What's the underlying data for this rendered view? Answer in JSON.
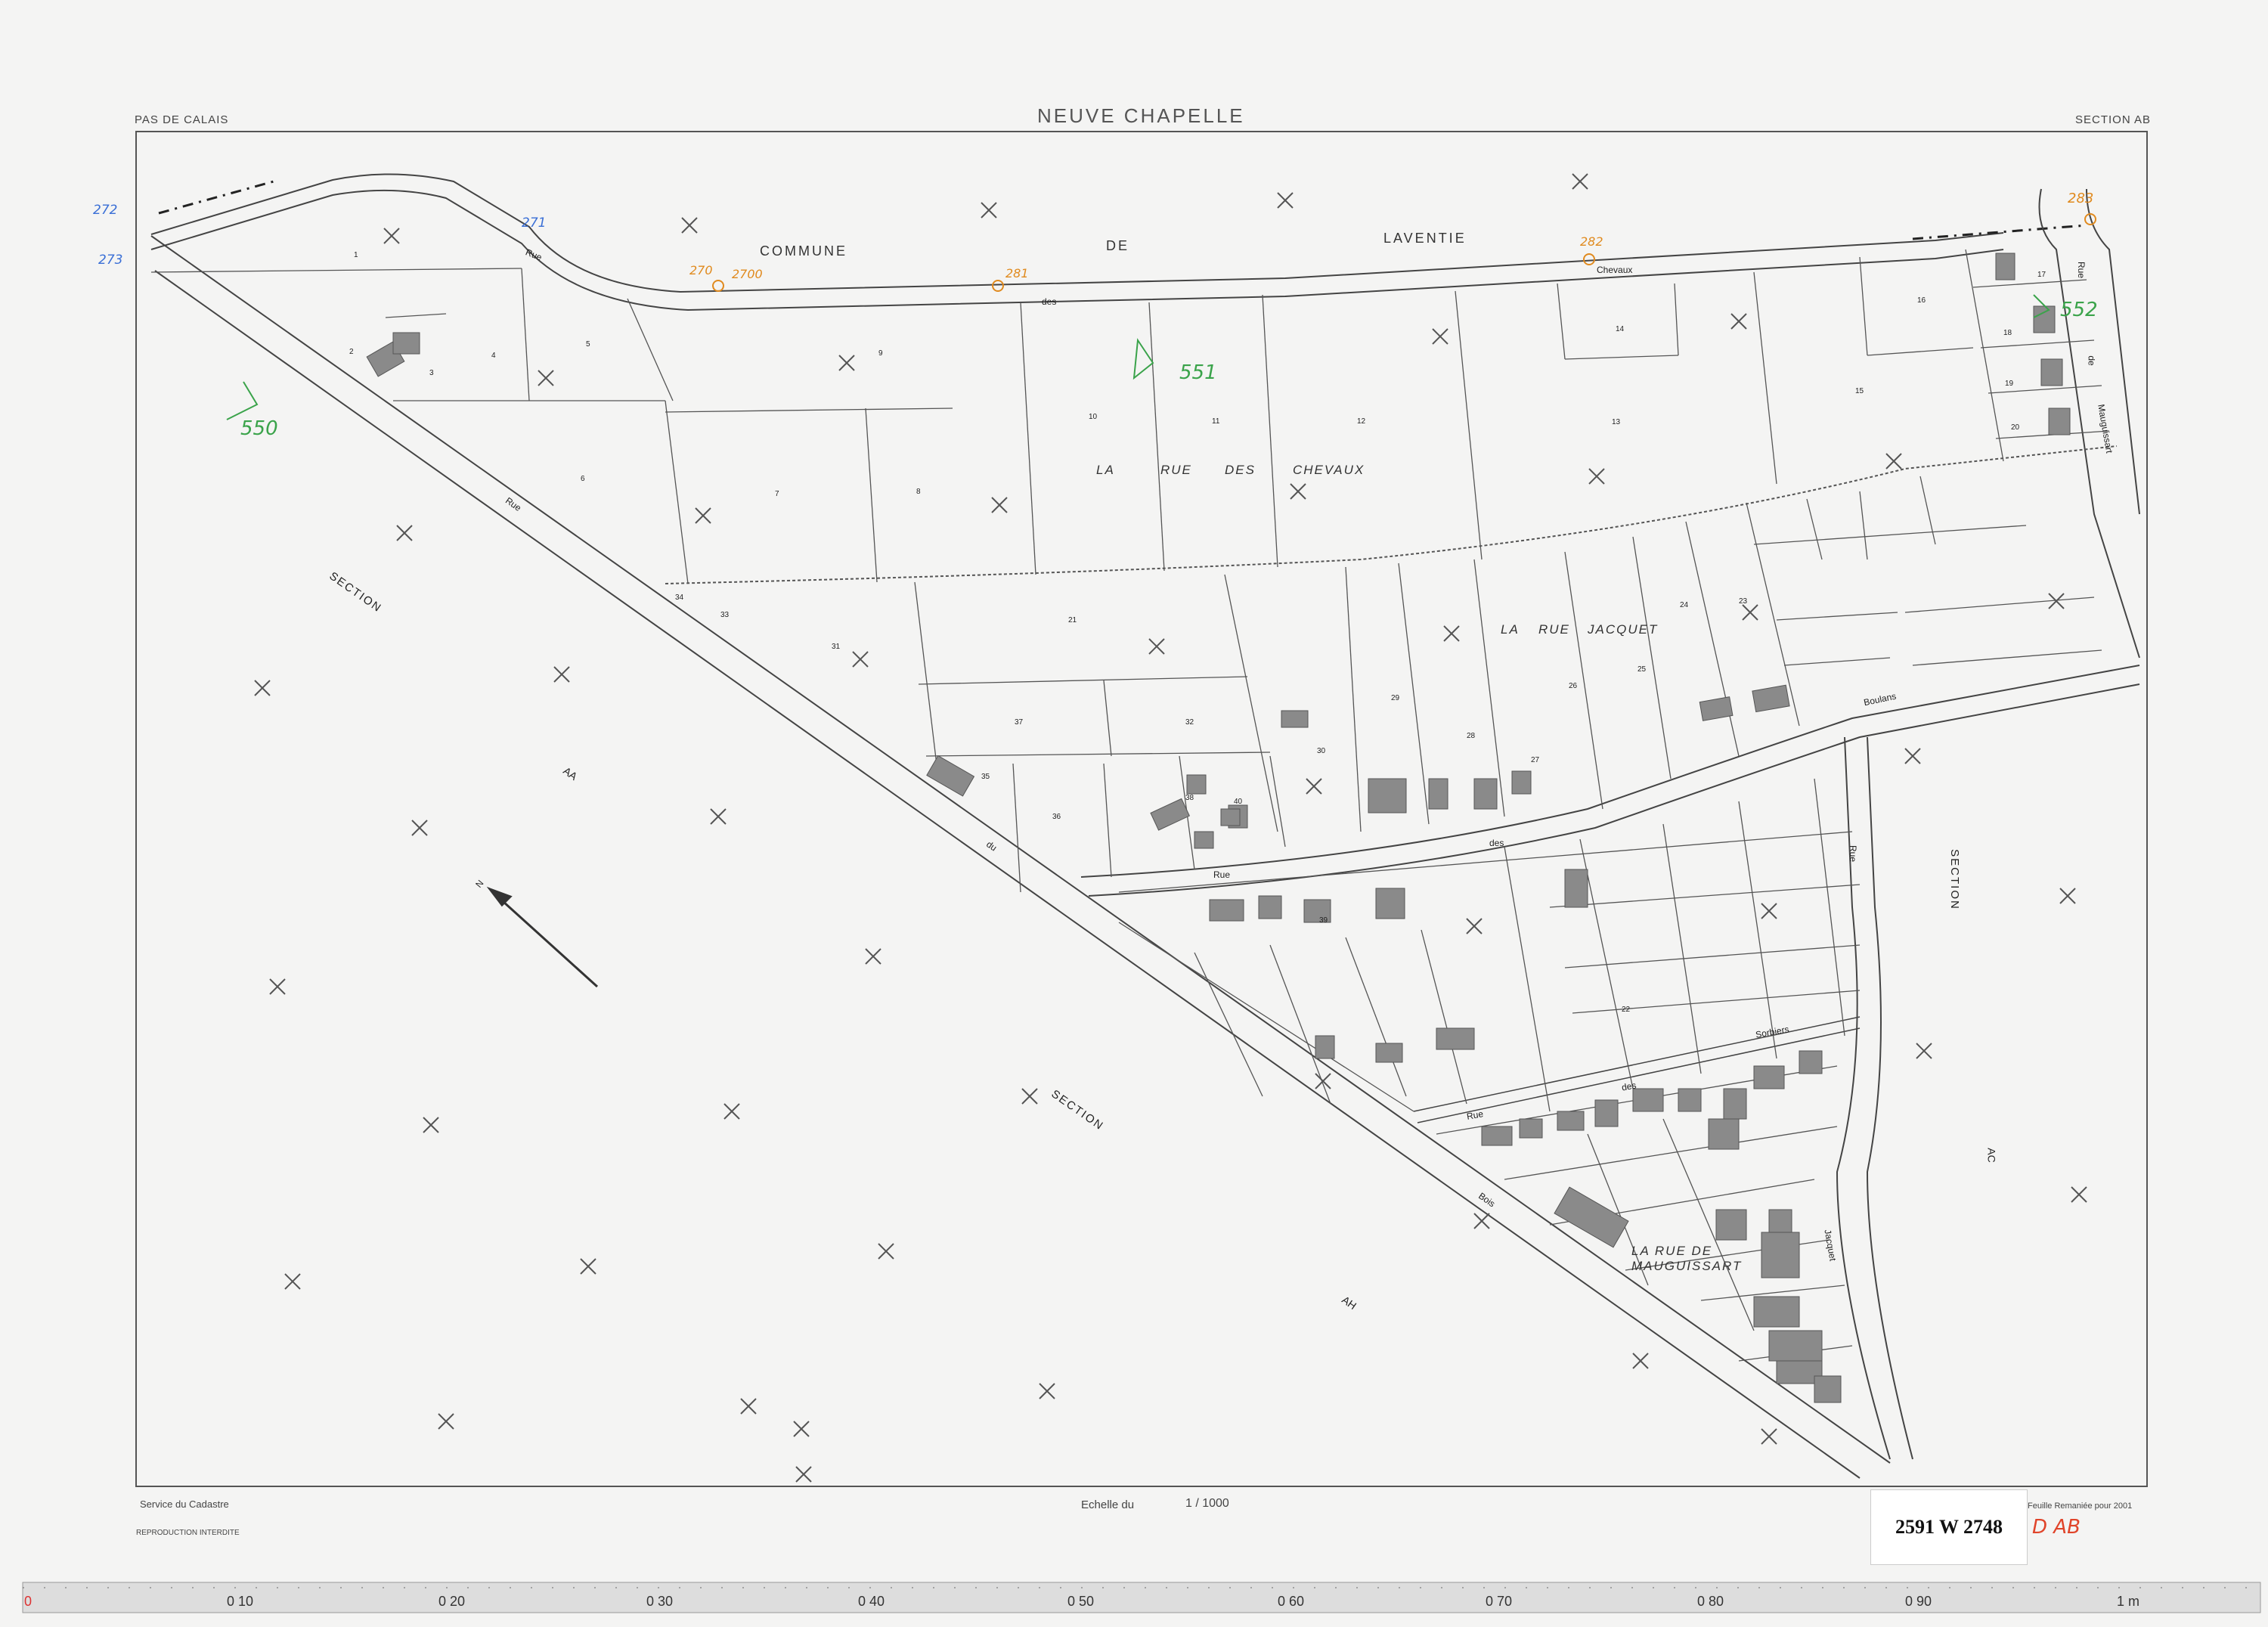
{
  "header": {
    "department": "PAS DE CALAIS",
    "commune": "NEUVE CHAPELLE",
    "section": "SECTION AB"
  },
  "footer": {
    "service": "Service du Cadastre",
    "reproduction": "REPRODUCTION   INTERDITE",
    "scale_label": "Echelle du",
    "scale_value": "1 / 1000",
    "remaniement": "Feuille Remaniée pour 2001",
    "archive_ref": "2591 W 2748",
    "archive_annotation": "D AB"
  },
  "place_names": {
    "commune_word": "COMMUNE",
    "de_word": "DE",
    "laventie": "LAVENTIE",
    "rue_des_chevaux": [
      "LA",
      "RUE",
      "DES",
      "CHEVAUX"
    ],
    "rue_jacquet": [
      "LA",
      "RUE",
      "JACQUET"
    ],
    "rue_mauguissart": "LA RUE DE\nMAUGUISSART"
  },
  "street_names": {
    "rue_top": "Rue",
    "des_top": "des",
    "chevaux": "Chevaux",
    "rue_mauguissart": "Rue",
    "de_mauguissart": "de",
    "mauguissart": "Mauguissart",
    "rue_du_bois_1": "Rue",
    "rue_du_bois_2": "du",
    "rue_du_bois_3": "Bois",
    "boulans": "Boulans",
    "des_mid": "des",
    "rue_mid": "Rue",
    "sorbiers": "Sorbiers",
    "des_sorbiers": "des",
    "rue_sorbiers": "Rue",
    "rue_jacquet_right": "Rue",
    "jacquet": "Jacquet"
  },
  "sections": {
    "aa_1": "SECTION",
    "aa_2": "AA",
    "ah_1": "SECTION",
    "ah_2": "AH",
    "ac_1": "SECTION",
    "ac_2": "AC"
  },
  "north_label": "N",
  "parcels": [
    "1",
    "2",
    "3",
    "4",
    "5",
    "6",
    "7",
    "8",
    "9",
    "10",
    "11",
    "12",
    "13",
    "14",
    "15",
    "16",
    "17",
    "18",
    "19",
    "20",
    "21",
    "22",
    "23",
    "24",
    "25",
    "26",
    "27",
    "28",
    "29",
    "30",
    "31",
    "32",
    "33",
    "34",
    "35",
    "36",
    "37",
    "38",
    "39",
    "40"
  ],
  "annotations": {
    "blue_1": "272",
    "blue_2": "273",
    "blue_3": "271",
    "orange_1": "270",
    "orange_2": "2700",
    "orange_3": "281",
    "orange_4": "282",
    "orange_5": "283",
    "green_1": "551",
    "green_2": "550",
    "green_3": "552"
  },
  "ruler": {
    "marks": [
      "0",
      "0 10",
      "0 20",
      "0 30",
      "0 40",
      "0 50",
      "0 60",
      "0 70",
      "0 80",
      "0 90",
      "1 m"
    ]
  },
  "colors": {
    "background": "#f4f4f3",
    "line": "#444444",
    "building": "#8a8a8a",
    "blue_ink": "#3a6fd6",
    "orange_ink": "#e08a1e",
    "green_ink": "#3aa34a",
    "red_ink": "#e0442a"
  }
}
